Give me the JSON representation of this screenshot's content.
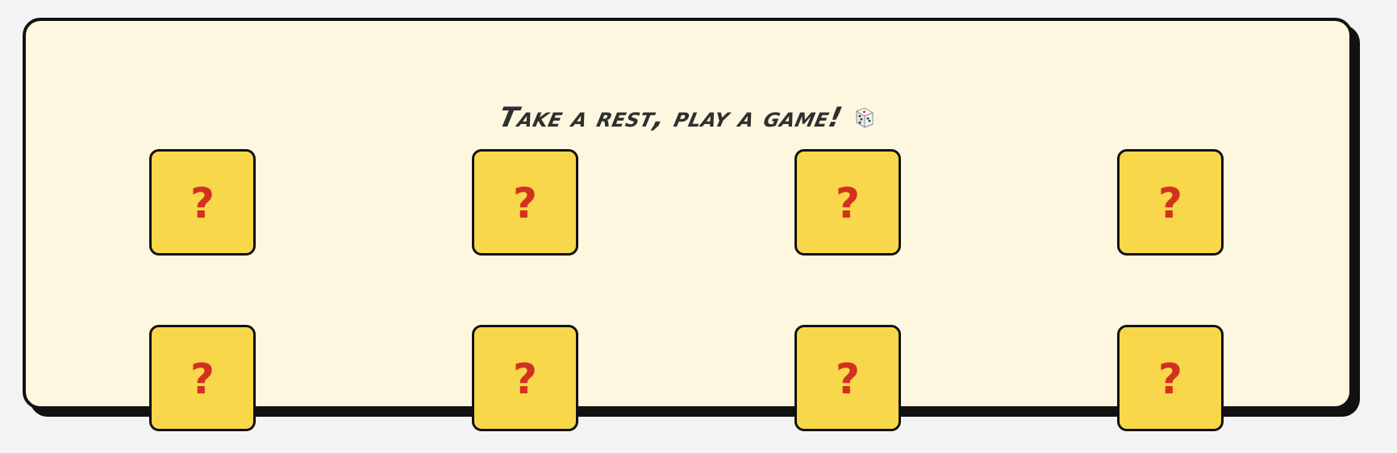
{
  "title": {
    "text": "Take a rest, play a game!",
    "icon": "dice-icon"
  },
  "cards": [
    {
      "label": "?"
    },
    {
      "label": "?"
    },
    {
      "label": "?"
    },
    {
      "label": "?"
    },
    {
      "label": "?"
    },
    {
      "label": "?"
    },
    {
      "label": "?"
    },
    {
      "label": "?"
    }
  ],
  "colors": {
    "background": "#f3f3f3",
    "panel": "#fdf7df",
    "card": "#f8d74a",
    "question_mark": "#d2311f",
    "outline": "#111111"
  }
}
